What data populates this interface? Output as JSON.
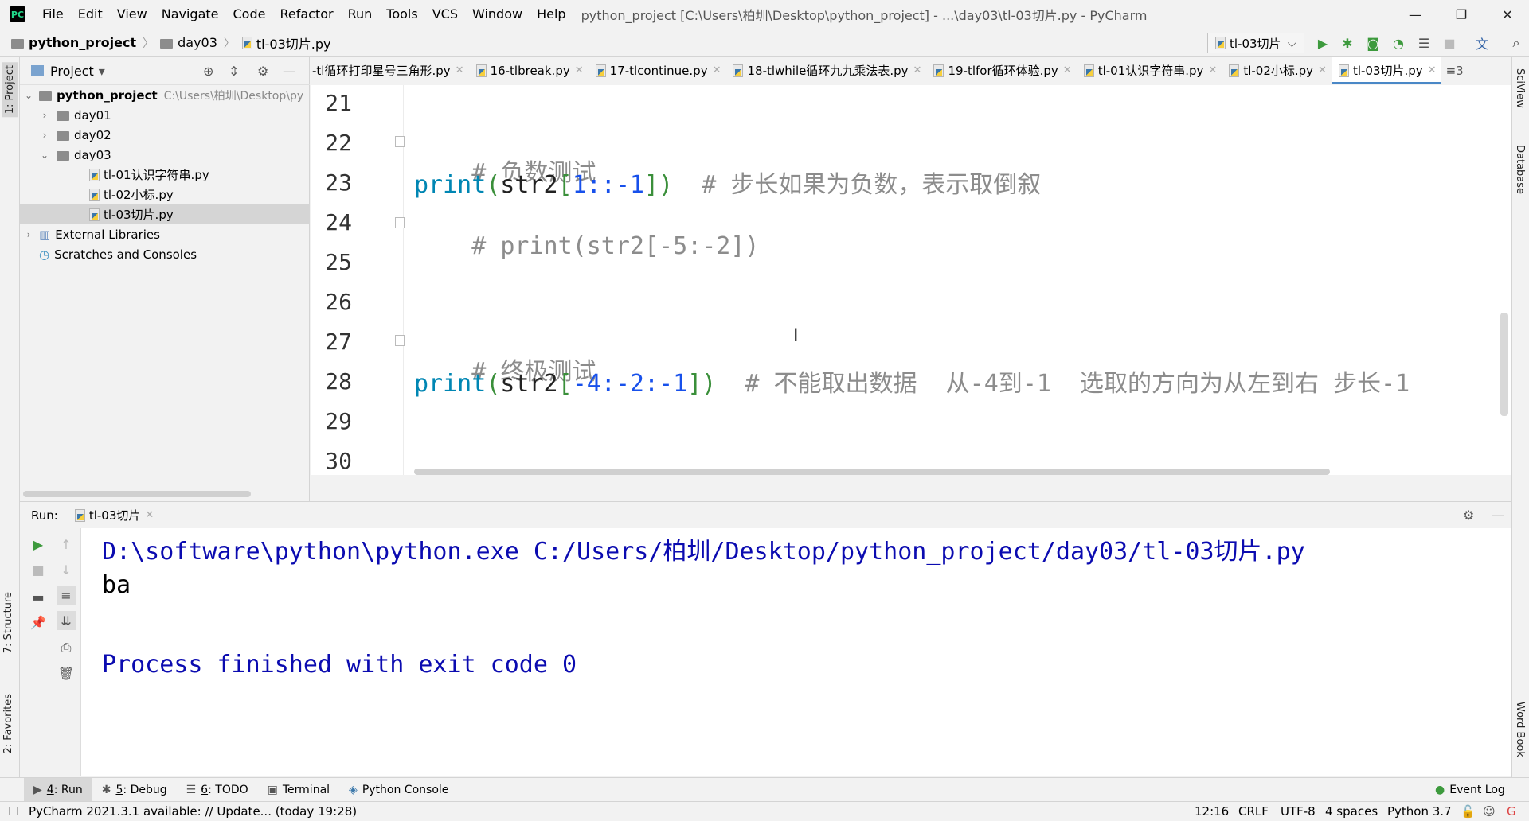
{
  "app": {
    "logo_text": "PC",
    "window_title": "python_project [C:\\Users\\柏圳\\Desktop\\python_project] - ...\\day03\\tl-03切片.py - PyCharm"
  },
  "menu": [
    "File",
    "Edit",
    "View",
    "Navigate",
    "Code",
    "Refactor",
    "Run",
    "Tools",
    "VCS",
    "Window",
    "Help"
  ],
  "breadcrumb": {
    "project": "python_project",
    "folder": "day03",
    "file": "tl-03切片.py"
  },
  "run_config": {
    "label": "tl-03切片",
    "arrow": "⌵"
  },
  "sidebar_labels": {
    "project": "1: Project",
    "structure": "7: Structure",
    "favorites": "2: Favorites",
    "sciview": "SciView",
    "database": "Database",
    "wordbook": "Word Book"
  },
  "project_panel": {
    "title": "Project",
    "dropdown": "▾",
    "tree": [
      {
        "label": "python_project",
        "path": "C:\\Users\\柏圳\\Desktop\\py",
        "type": "root",
        "expanded": true
      },
      {
        "label": "day01",
        "type": "folder",
        "expanded": false
      },
      {
        "label": "day02",
        "type": "folder",
        "expanded": false
      },
      {
        "label": "day03",
        "type": "folder",
        "expanded": true
      },
      {
        "label": "tl-01认识字符串.py",
        "type": "file"
      },
      {
        "label": "tl-02小标.py",
        "type": "file"
      },
      {
        "label": "tl-03切片.py",
        "type": "file",
        "selected": true
      },
      {
        "label": "External Libraries",
        "type": "library"
      },
      {
        "label": "Scratches and Consoles",
        "type": "scratch"
      }
    ]
  },
  "editor_tabs": [
    {
      "label": "-tl循环打印星号三角形.py"
    },
    {
      "label": "16-tlbreak.py"
    },
    {
      "label": "17-tlcontinue.py"
    },
    {
      "label": "18-tlwhile循环九九乘法表.py"
    },
    {
      "label": "19-tlfor循环体验.py"
    },
    {
      "label": "tl-01认识字符串.py"
    },
    {
      "label": "tl-02小标.py"
    },
    {
      "label": "tl-03切片.py",
      "active": true
    }
  ],
  "tabs_overflow": "≡3",
  "code_lines": [
    {
      "num": "21"
    },
    {
      "num": "22",
      "comment": "# 负数测试"
    },
    {
      "num": "23",
      "fn": "print",
      "p1": "(",
      "id": "str2",
      "b1": "[",
      "n1": "1::-1",
      "b2": "]",
      "p2": ")",
      "comment": "  # 步长如果为负数，表示取倒叙"
    },
    {
      "num": "24",
      "comment": "# print(str2[-5:-2])"
    },
    {
      "num": "25"
    },
    {
      "num": "26"
    },
    {
      "num": "27",
      "comment": "# 终极测试"
    },
    {
      "num": "28",
      "fn": "print",
      "p1": "(",
      "id": "str2",
      "b1": "[",
      "n1": "-4:-2:-1",
      "b2": "]",
      "p2": ")",
      "comment": "  # 不能取出数据  从-4到-1  选取的方向为从左到右 步长-1"
    },
    {
      "num": "29"
    },
    {
      "num": "30"
    }
  ],
  "run_panel": {
    "label": "Run:",
    "tab": "tl-03切片",
    "console": [
      "D:\\software\\python\\python.exe C:/Users/柏圳/Desktop/python_project/day03/tl-03切片.py",
      "ba",
      "",
      "Process finished with exit code 0"
    ]
  },
  "bottom_tabs": [
    {
      "num": "4",
      "label": "Run",
      "active": true
    },
    {
      "num": "5",
      "label": "Debug"
    },
    {
      "num": "6",
      "label": "TODO"
    },
    {
      "label": "Terminal"
    },
    {
      "label": "Python Console"
    }
  ],
  "event_log": "Event Log",
  "status": {
    "message": "PyCharm 2021.3.1 available: // Update... (today 19:28)",
    "position": "12:16",
    "line_ending": "CRLF",
    "encoding": "UTF-8",
    "indent": "4 spaces",
    "interpreter": "Python 3.7"
  },
  "colors": {
    "accent": "#4a88c7",
    "console_text": "#0b0bb0",
    "comment": "#8c8c8c",
    "function": "#0086b3",
    "number": "#1750eb"
  }
}
